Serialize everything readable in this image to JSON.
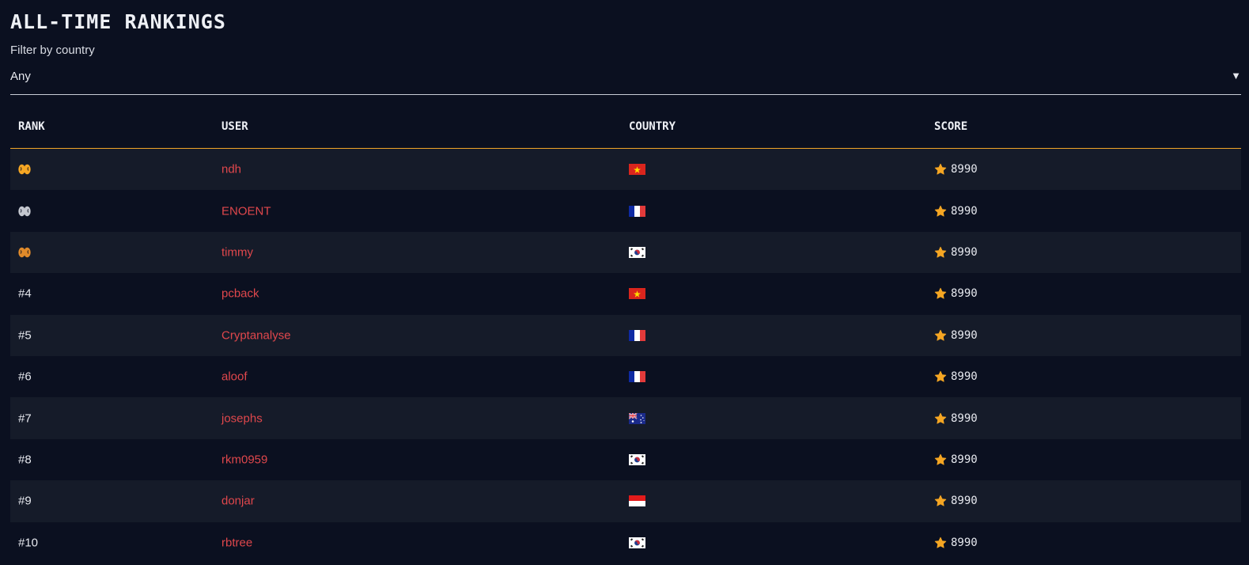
{
  "page": {
    "title": "ALL-TIME RANKINGS",
    "filter_label": "Filter by country",
    "filter_value": "Any",
    "filter_caret": "▼"
  },
  "table": {
    "headers": {
      "rank": "RANK",
      "user": "USER",
      "country": "COUNTRY",
      "score": "SCORE"
    },
    "rows": [
      {
        "rank": "",
        "medal": "gold",
        "user": "ndh",
        "country": "vietnam",
        "score": "8990"
      },
      {
        "rank": "",
        "medal": "silver",
        "user": "ENOENT",
        "country": "france",
        "score": "8990"
      },
      {
        "rank": "",
        "medal": "bronze",
        "user": "timmy",
        "country": "south-korea",
        "score": "8990"
      },
      {
        "rank": "#4",
        "medal": "",
        "user": "pcback",
        "country": "vietnam",
        "score": "8990"
      },
      {
        "rank": "#5",
        "medal": "",
        "user": "Cryptanalyse",
        "country": "france",
        "score": "8990"
      },
      {
        "rank": "#6",
        "medal": "",
        "user": "aloof",
        "country": "france",
        "score": "8990"
      },
      {
        "rank": "#7",
        "medal": "",
        "user": "josephs",
        "country": "australia",
        "score": "8990"
      },
      {
        "rank": "#8",
        "medal": "",
        "user": "rkm0959",
        "country": "south-korea",
        "score": "8990"
      },
      {
        "rank": "#9",
        "medal": "",
        "user": "donjar",
        "country": "indonesia",
        "score": "8990"
      },
      {
        "rank": "#10",
        "medal": "",
        "user": "rbtree",
        "country": "south-korea",
        "score": "8990"
      }
    ]
  },
  "icons": {
    "medal": "brain-icon",
    "score": "star-icon"
  },
  "colors": {
    "background": "#0b1020",
    "row_alt": "#151b29",
    "accent": "#f0a428",
    "username": "#e0474c",
    "gold": "#f5a623",
    "silver": "#c4c7cf",
    "bronze": "#e08a2a"
  }
}
